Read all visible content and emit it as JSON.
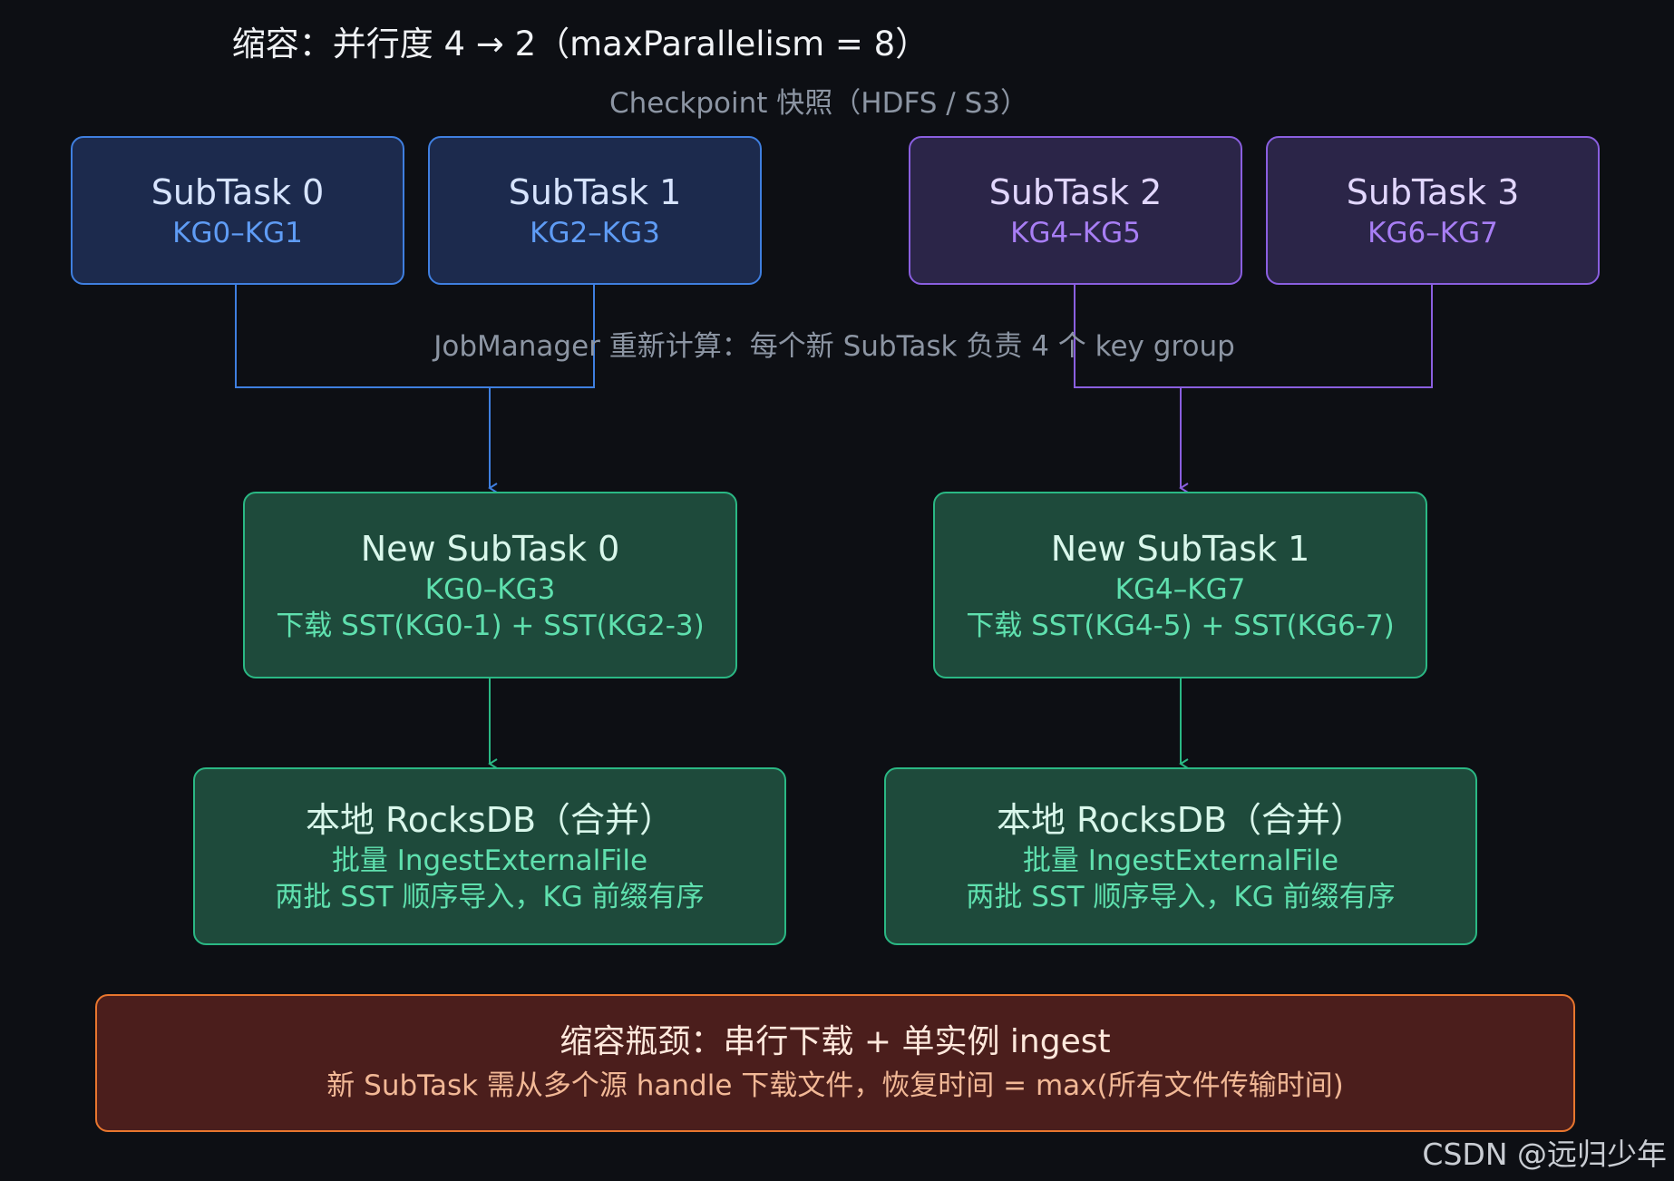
{
  "title": "缩容：并行度 4 → 2（maxParallelism = 8）",
  "subtitle": "Checkpoint 快照（HDFS / S3）",
  "old_subtasks": [
    {
      "name": "SubTask 0",
      "range": "KG0–KG1"
    },
    {
      "name": "SubTask 1",
      "range": "KG2–KG3"
    },
    {
      "name": "SubTask 2",
      "range": "KG4–KG5"
    },
    {
      "name": "SubTask 3",
      "range": "KG6–KG7"
    }
  ],
  "jobmanager_note": "JobManager 重新计算：每个新 SubTask 负责 4 个 key group",
  "new_subtasks": [
    {
      "name": "New SubTask 0",
      "range": "KG0–KG3",
      "download": "下载 SST(KG0-1) + SST(KG2-3)"
    },
    {
      "name": "New SubTask 1",
      "range": "KG4–KG7",
      "download": "下载 SST(KG4-5) + SST(KG6-7)"
    }
  ],
  "rocksdb": [
    {
      "title": "本地 RocksDB（合并）",
      "line1": "批量 IngestExternalFile",
      "line2": "两批 SST 顺序导入，KG 前缀有序"
    },
    {
      "title": "本地 RocksDB（合并）",
      "line1": "批量 IngestExternalFile",
      "line2": "两批 SST 顺序导入，KG 前缀有序"
    }
  ],
  "bottleneck": {
    "title": "缩容瓶颈：串行下载 + 单实例 ingest",
    "detail": "新 SubTask 需从多个源 handle 下载文件，恢复时间 = max(所有文件传输时间)"
  },
  "watermark": "CSDN @远归少年",
  "colors": {
    "background": "#0d0f14",
    "blue": "#3f7fe0",
    "purple": "#8a5fe0",
    "green": "#2ab884",
    "orange": "#e8762e"
  }
}
